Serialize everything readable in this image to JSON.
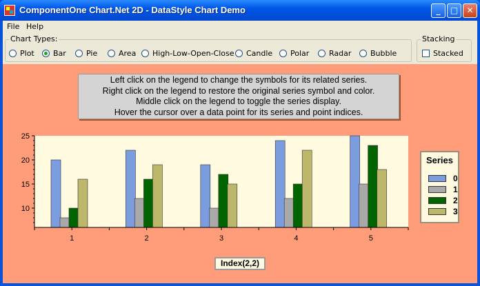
{
  "window": {
    "title": "ComponentOne Chart.Net 2D - DataStyle Chart Demo",
    "minimize_glyph": "_",
    "maximize_glyph": "□",
    "close_glyph": "✕"
  },
  "menu": {
    "file": "File",
    "help": "Help"
  },
  "chart_types": {
    "label": "Chart Types:",
    "options": [
      "Plot",
      "Bar",
      "Pie",
      "Area",
      "High-Low-Open-Close",
      "Candle",
      "Polar",
      "Radar",
      "Bubble"
    ],
    "selected": "Bar"
  },
  "stacking": {
    "label": "Stacking",
    "checkbox_label": "Stacked",
    "checked": false
  },
  "instructions": {
    "line1": "Left click on the legend to change the symbols for its related series.",
    "line2": "Right click on the legend to restore the original series symbol and color.",
    "line3": "Middle click on the legend to toggle the series display.",
    "line4": "Hover the cursor over a data point for its series and point indices."
  },
  "legend": {
    "title": "Series",
    "entries": [
      {
        "label": "0",
        "color": "#7b9de0"
      },
      {
        "label": "1",
        "color": "#a9a9a9"
      },
      {
        "label": "2",
        "color": "#006400"
      },
      {
        "label": "3",
        "color": "#bdb76b"
      }
    ]
  },
  "status_label": "Index(2,2)",
  "colors": {
    "chart_background": "#ff9c7a",
    "plot_background": "#fffae0",
    "title_bar": "#0058e6"
  },
  "chart_data": {
    "type": "bar",
    "categories": [
      "1",
      "2",
      "3",
      "4",
      "5"
    ],
    "series": [
      {
        "name": "0",
        "values": [
          20,
          22,
          19,
          24,
          25
        ],
        "color": "#7b9de0"
      },
      {
        "name": "1",
        "values": [
          8,
          12,
          10,
          12,
          15
        ],
        "color": "#a9a9a9"
      },
      {
        "name": "2",
        "values": [
          10,
          16,
          17,
          15,
          23
        ],
        "color": "#006400"
      },
      {
        "name": "3",
        "values": [
          16,
          19,
          15,
          22,
          18
        ],
        "color": "#bdb76b"
      }
    ],
    "y_ticks": [
      "10",
      "15",
      "20",
      "25"
    ],
    "ylim": [
      6,
      25
    ],
    "legend_position": "right"
  }
}
